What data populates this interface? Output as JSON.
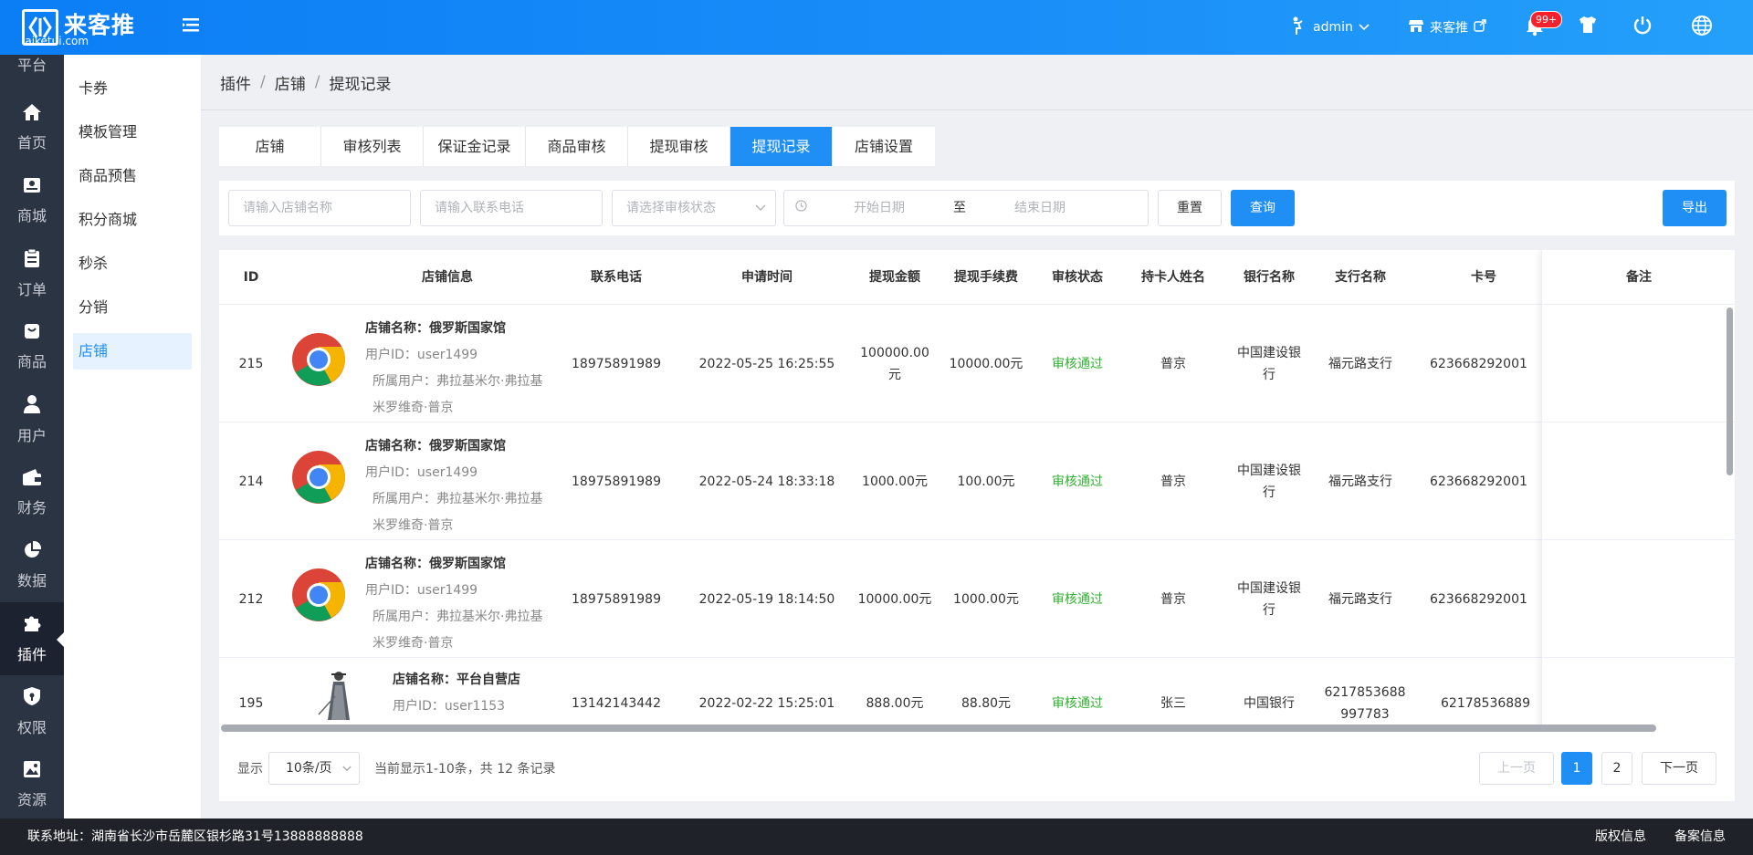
{
  "brand": {
    "name": "来客推",
    "url": "laiketui.com"
  },
  "topbar": {
    "user": "admin",
    "shop": "来客推",
    "badge": "99+"
  },
  "side_menu": [
    {
      "label": "平台",
      "icon": "platform-icon"
    },
    {
      "label": "首页",
      "icon": "home-icon"
    },
    {
      "label": "商城",
      "icon": "store-icon"
    },
    {
      "label": "订单",
      "icon": "clipboard-icon"
    },
    {
      "label": "商品",
      "icon": "bag-icon"
    },
    {
      "label": "用户",
      "icon": "user-icon"
    },
    {
      "label": "财务",
      "icon": "wallet-icon"
    },
    {
      "label": "数据",
      "icon": "pie-chart-icon"
    },
    {
      "label": "插件",
      "icon": "puzzle-icon"
    },
    {
      "label": "权限",
      "icon": "shield-icon"
    },
    {
      "label": "资源",
      "icon": "image-icon"
    }
  ],
  "sub_menu": [
    "卡券",
    "模板管理",
    "商品预售",
    "积分商城",
    "秒杀",
    "分销",
    "店铺"
  ],
  "breadcrumb": [
    "插件",
    "店铺",
    "提现记录"
  ],
  "tabs": [
    "店铺",
    "审核列表",
    "保证金记录",
    "商品审核",
    "提现审核",
    "提现记录",
    "店铺设置"
  ],
  "filters": {
    "store_name_placeholder": "请输入店铺名称",
    "phone_placeholder": "请输入联系电话",
    "status_placeholder": "请选择审核状态",
    "start_date": "开始日期",
    "to": "至",
    "end_date": "结束日期",
    "reset": "重置",
    "query": "查询",
    "export": "导出"
  },
  "table": {
    "headers": [
      "ID",
      "店铺信息",
      "联系电话",
      "申请时间",
      "提现金额",
      "提现手续费",
      "审核状态",
      "持卡人姓名",
      "银行名称",
      "支行名称",
      "卡号",
      "备注"
    ],
    "rows": [
      {
        "id": "215",
        "store_name": "店铺名称：俄罗斯国家馆",
        "user_id": "用户ID：user1499",
        "owner": "所属用户：弗拉基米尔·弗拉基米罗维奇·普京",
        "phone": "18975891989",
        "time": "2022-05-25 16:25:55",
        "amount": "100000.00元",
        "fee": "10000.00元",
        "status": "审核通过",
        "holder": "普京",
        "bank": "中国建设银行",
        "branch": "福元路支行",
        "card": "623668292001"
      },
      {
        "id": "214",
        "store_name": "店铺名称：俄罗斯国家馆",
        "user_id": "用户ID：user1499",
        "owner": "所属用户：弗拉基米尔·弗拉基米罗维奇·普京",
        "phone": "18975891989",
        "time": "2022-05-24 18:33:18",
        "amount": "1000.00元",
        "fee": "100.00元",
        "status": "审核通过",
        "holder": "普京",
        "bank": "中国建设银行",
        "branch": "福元路支行",
        "card": "623668292001"
      },
      {
        "id": "212",
        "store_name": "店铺名称：俄罗斯国家馆",
        "user_id": "用户ID：user1499",
        "owner": "所属用户：弗拉基米尔·弗拉基米罗维奇·普京",
        "phone": "18975891989",
        "time": "2022-05-19 18:14:50",
        "amount": "10000.00元",
        "fee": "1000.00元",
        "status": "审核通过",
        "holder": "普京",
        "bank": "中国建设银行",
        "branch": "福元路支行",
        "card": "623668292001"
      },
      {
        "id": "195",
        "store_name": "店铺名称：平台自营店",
        "user_id": "用户ID：user1153",
        "owner": "",
        "phone": "13142143442",
        "time": "2022-02-22 15:25:01",
        "amount": "888.00元",
        "fee": "88.80元",
        "status": "审核通过",
        "holder": "张三",
        "bank": "中国银行",
        "branch": "6217853688997783",
        "card": "62178536889"
      }
    ]
  },
  "pagination": {
    "show": "显示",
    "page_size": "10条/页",
    "summary": "当前显示1-10条，共 12 条记录",
    "prev": "上一页",
    "pages": [
      "1",
      "2"
    ],
    "next": "下一页"
  },
  "footer": {
    "address": "联系地址：湖南省长沙市岳麓区银杉路31号13888888888",
    "copyright": "版权信息",
    "record": "备案信息"
  }
}
